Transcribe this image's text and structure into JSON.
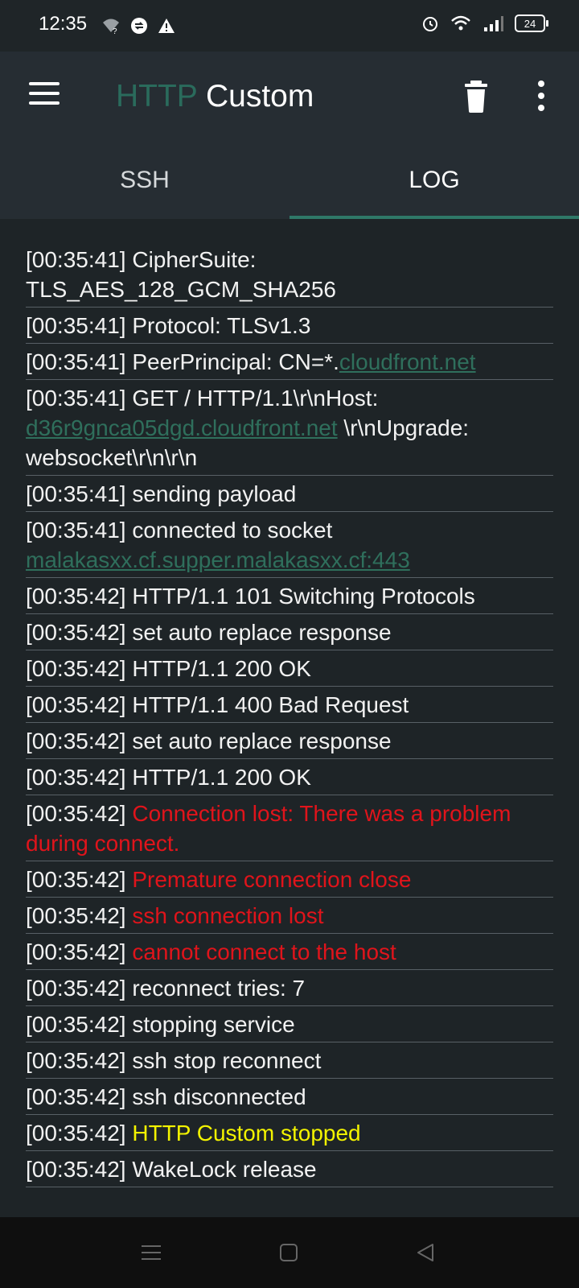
{
  "status_bar": {
    "time": "12:35",
    "left_icons": [
      "wifi-question-icon",
      "sync-icon",
      "warning-icon"
    ],
    "right_icons": [
      "alarm-icon",
      "wifi-icon",
      "signal-icon"
    ],
    "battery": "24"
  },
  "app_bar": {
    "title_part1": "HTTP",
    "title_part2": "Custom",
    "title_color_accent": "#2a6b5c"
  },
  "tabs": [
    {
      "label": "SSH",
      "active": false
    },
    {
      "label": "LOG",
      "active": true
    }
  ],
  "log": [
    {
      "ts": "[00:35:41]",
      "parts": [
        {
          "text": " CipherSuite: TLS_AES_128_GCM_SHA256",
          "style": "normal"
        }
      ]
    },
    {
      "ts": "[00:35:41]",
      "parts": [
        {
          "text": " Protocol: TLSv1.3",
          "style": "normal"
        }
      ]
    },
    {
      "ts": "[00:35:41]",
      "parts": [
        {
          "text": " PeerPrincipal: CN=*.",
          "style": "normal"
        },
        {
          "text": "cloudfront.net",
          "style": "link"
        }
      ]
    },
    {
      "ts": "[00:35:41]",
      "parts": [
        {
          "text": " GET / HTTP/1.1\\r\\nHost: ",
          "style": "normal"
        },
        {
          "text": "d36r9gnca05dgd.cloudfront.net",
          "style": "link"
        },
        {
          "text": " \\r\\nUpgrade: websocket\\r\\n\\r\\n",
          "style": "normal"
        }
      ]
    },
    {
      "ts": "[00:35:41]",
      "parts": [
        {
          "text": " sending payload",
          "style": "normal"
        }
      ]
    },
    {
      "ts": "[00:35:41]",
      "parts": [
        {
          "text": " connected to socket ",
          "style": "normal"
        },
        {
          "text": "malakasxx.cf.supper.malakasxx.cf:443",
          "style": "link"
        }
      ]
    },
    {
      "ts": "[00:35:42]",
      "parts": [
        {
          "text": " HTTP/1.1 101 Switching Protocols",
          "style": "normal"
        }
      ]
    },
    {
      "ts": "[00:35:42]",
      "parts": [
        {
          "text": " set auto replace response",
          "style": "normal"
        }
      ]
    },
    {
      "ts": "[00:35:42]",
      "parts": [
        {
          "text": " HTTP/1.1 200 OK",
          "style": "normal"
        }
      ]
    },
    {
      "ts": "[00:35:42]",
      "parts": [
        {
          "text": " HTTP/1.1 400 Bad Request",
          "style": "normal"
        }
      ]
    },
    {
      "ts": "[00:35:42]",
      "parts": [
        {
          "text": " set auto replace response",
          "style": "normal"
        }
      ]
    },
    {
      "ts": "[00:35:42]",
      "parts": [
        {
          "text": " HTTP/1.1 200 OK",
          "style": "normal"
        }
      ]
    },
    {
      "ts": "[00:35:42]",
      "parts": [
        {
          "text": " Connection lost: There was a problem during connect.",
          "style": "red"
        }
      ]
    },
    {
      "ts": "[00:35:42]",
      "parts": [
        {
          "text": " Premature connection close",
          "style": "red"
        }
      ]
    },
    {
      "ts": "[00:35:42]",
      "parts": [
        {
          "text": " ssh connection lost",
          "style": "red"
        }
      ]
    },
    {
      "ts": "[00:35:42]",
      "parts": [
        {
          "text": " cannot connect to the host",
          "style": "red"
        }
      ]
    },
    {
      "ts": "[00:35:42]",
      "parts": [
        {
          "text": " reconnect tries: 7",
          "style": "normal"
        }
      ]
    },
    {
      "ts": "[00:35:42]",
      "parts": [
        {
          "text": " stopping service",
          "style": "normal"
        }
      ]
    },
    {
      "ts": "[00:35:42]",
      "parts": [
        {
          "text": " ssh stop reconnect",
          "style": "normal"
        }
      ]
    },
    {
      "ts": "[00:35:42]",
      "parts": [
        {
          "text": " ssh disconnected",
          "style": "normal"
        }
      ]
    },
    {
      "ts": "[00:35:42]",
      "parts": [
        {
          "text": " HTTP Custom stopped",
          "style": "yellow"
        }
      ]
    },
    {
      "ts": "[00:35:42]",
      "parts": [
        {
          "text": " WakeLock release",
          "style": "normal"
        }
      ]
    }
  ],
  "colors": {
    "background": "#1e2427",
    "appbar": "#262d33",
    "error": "#e0141b",
    "success": "#f3f300",
    "link": "#2f6f5c"
  },
  "nav_bar": {
    "icons": [
      "recents-icon",
      "home-icon",
      "back-icon"
    ]
  }
}
